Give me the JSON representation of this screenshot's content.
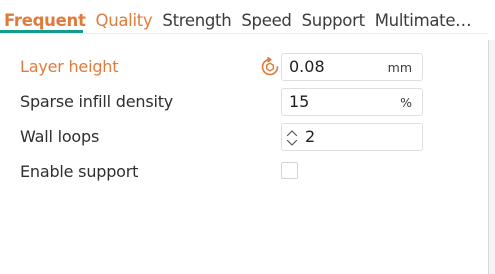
{
  "tabs": [
    {
      "label": "Frequent",
      "state": "active"
    },
    {
      "label": "Quality",
      "state": "modified"
    },
    {
      "label": "Strength",
      "state": "normal"
    },
    {
      "label": "Speed",
      "state": "normal"
    },
    {
      "label": "Support",
      "state": "normal"
    },
    {
      "label": "Multimate…",
      "state": "normal"
    }
  ],
  "settings": {
    "layer_height": {
      "label": "Layer height",
      "value": "0.08",
      "unit": "mm",
      "modified": true,
      "icon": "reset-icon"
    },
    "sparse_infill_density": {
      "label": "Sparse infill density",
      "value": "15",
      "unit": "%"
    },
    "wall_loops": {
      "label": "Wall loops",
      "value": "2",
      "icon": "spin-arrows-icon"
    },
    "enable_support": {
      "label": "Enable support",
      "checked": false
    }
  },
  "colors": {
    "accent_orange": "#e07b3e",
    "accent_teal": "#139c8c",
    "text": "#2f2f2f",
    "border": "#dedede"
  }
}
